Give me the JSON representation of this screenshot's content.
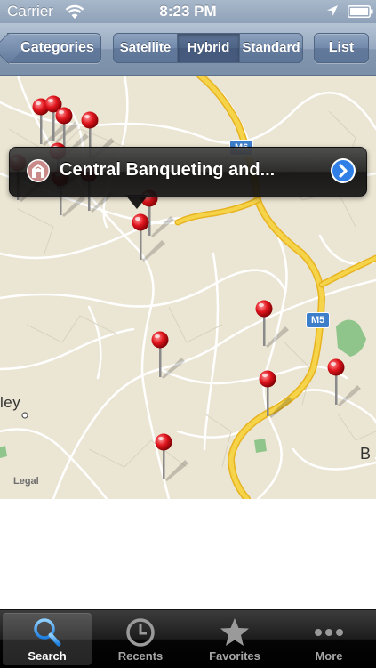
{
  "status_bar": {
    "carrier": "Carrier",
    "time": "8:23 PM",
    "icons": [
      "wifi-icon",
      "location-arrow-icon",
      "battery-icon"
    ]
  },
  "nav_bar": {
    "back_label": "Categories",
    "map_types": [
      {
        "label": "Satellite",
        "selected": false
      },
      {
        "label": "Hybrid",
        "selected": true
      },
      {
        "label": "Standard",
        "selected": false
      }
    ],
    "list_label": "List"
  },
  "map": {
    "callout_title": "Central Banqueting and...",
    "callout_icon": "venue-category-icon",
    "callout_action_icon": "disclosure-arrow-icon",
    "road_labels": [
      "M6",
      "M5"
    ],
    "place_labels": [
      "ley",
      "B"
    ],
    "legal_label": "Legal",
    "pin_count": 14,
    "colors": {
      "pin": "#e0141c",
      "motorway": "#f4c93c",
      "park": "#8fc58a"
    }
  },
  "tab_bar": {
    "tabs": [
      {
        "label": "Search",
        "icon": "search-icon",
        "active": true
      },
      {
        "label": "Recents",
        "icon": "clock-icon",
        "active": false
      },
      {
        "label": "Favorites",
        "icon": "star-icon",
        "active": false
      },
      {
        "label": "More",
        "icon": "more-dots-icon",
        "active": false
      }
    ]
  }
}
